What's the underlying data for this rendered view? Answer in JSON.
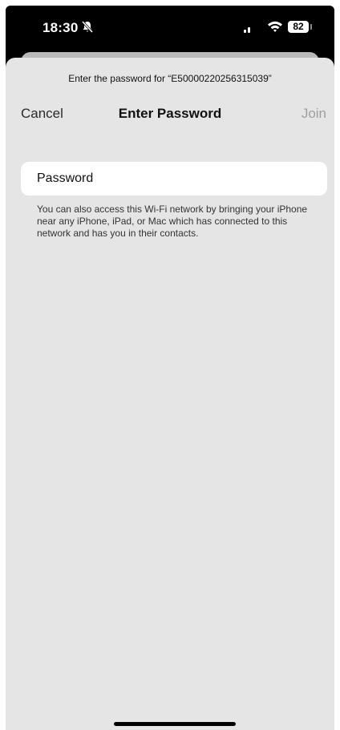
{
  "status_bar": {
    "time": "18:30",
    "battery": "82",
    "icons": [
      "bell-slash-icon",
      "cellular-signal-icon",
      "wifi-icon",
      "battery-icon"
    ]
  },
  "sheet": {
    "prompt": "Enter the password for “E50000220256315039”",
    "nav": {
      "cancel_label": "Cancel",
      "title": "Enter Password",
      "join_label": "Join"
    },
    "password_field": {
      "placeholder": "Password",
      "value": ""
    },
    "footnote": "You can also access this Wi-Fi network by bringing your iPhone near any iPhone, iPad, or Mac which has connected to this network and has you in their contacts."
  },
  "colors": {
    "sheet_background": "#e5e5e5",
    "field_background": "#ffffff",
    "join_disabled": "#9e9e9e",
    "status_bar_background": "#000000"
  }
}
